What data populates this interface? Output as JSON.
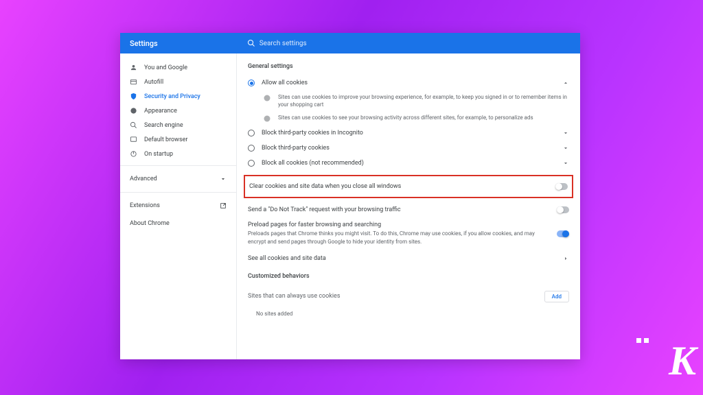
{
  "header": {
    "title": "Settings",
    "search_placeholder": "Search settings"
  },
  "sidebar": {
    "items": [
      {
        "label": "You and Google",
        "icon": "person"
      },
      {
        "label": "Autofill",
        "icon": "autofill"
      },
      {
        "label": "Security and Privacy",
        "icon": "shield",
        "active": true
      },
      {
        "label": "Appearance",
        "icon": "palette"
      },
      {
        "label": "Search engine",
        "icon": "search"
      },
      {
        "label": "Default browser",
        "icon": "browser"
      },
      {
        "label": "On startup",
        "icon": "power"
      }
    ],
    "advanced": "Advanced",
    "extensions": "Extensions",
    "about": "About Chrome"
  },
  "main": {
    "general_label": "General settings",
    "options": [
      {
        "label": "Allow all cookies",
        "selected": true,
        "expanded": true
      },
      {
        "label": "Block third-party cookies in Incognito",
        "selected": false
      },
      {
        "label": "Block third-party cookies",
        "selected": false
      },
      {
        "label": "Block all cookies (not recommended)",
        "selected": false
      }
    ],
    "info": [
      "Sites can use cookies to improve your browsing experience, for example, to keep you signed in or to remember items in your shopping cart",
      "Sites can use cookies to see your browsing activity across different sites, for example, to personalize ads"
    ],
    "clear_cookies": "Clear cookies and site data when you close all windows",
    "dnt": "Send a \"Do Not Track\" request with your browsing traffic",
    "preload_title": "Preload pages for faster browsing and searching",
    "preload_desc": "Preloads pages that Chrome thinks you might visit. To do this, Chrome may use cookies, if you allow cookies, and may encrypt and send pages through Google to hide your identity from sites.",
    "see_all": "See all cookies and site data",
    "customized_label": "Customized behaviors",
    "sites_always": "Sites that can always use cookies",
    "add_btn": "Add",
    "no_sites": "No sites added"
  },
  "watermark": "K"
}
